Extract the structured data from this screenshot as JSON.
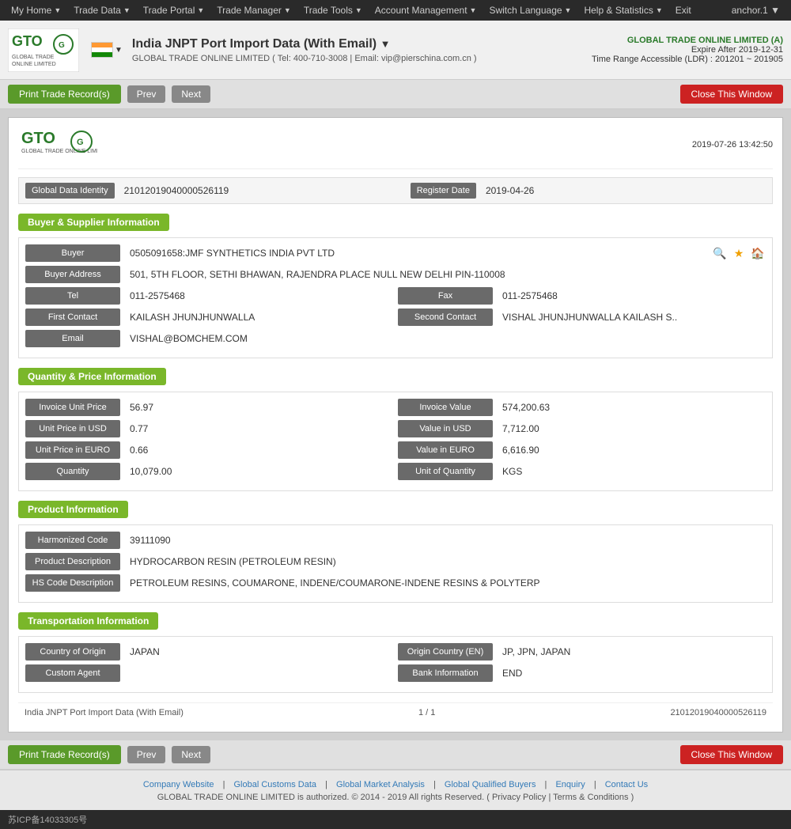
{
  "nav": {
    "items": [
      {
        "label": "My Home",
        "arrow": true
      },
      {
        "label": "Trade Data",
        "arrow": true
      },
      {
        "label": "Trade Portal",
        "arrow": true
      },
      {
        "label": "Trade Manager",
        "arrow": true
      },
      {
        "label": "Trade Tools",
        "arrow": true
      },
      {
        "label": "Account Management",
        "arrow": true
      },
      {
        "label": "Switch Language",
        "arrow": true
      },
      {
        "label": "Help & Statistics",
        "arrow": true
      },
      {
        "label": "Exit",
        "arrow": false
      }
    ],
    "anchor": "anchor.1 ▼"
  },
  "header": {
    "title": "India JNPT Port Import Data (With Email)",
    "title_arrow": "▼",
    "company_line": "GLOBAL TRADE ONLINE LIMITED ( Tel: 400-710-3008 | Email: vip@pierschina.com.cn )",
    "account_company": "GLOBAL TRADE ONLINE LIMITED (A)",
    "expire": "Expire After 2019-12-31",
    "ldr": "Time Range Accessible (LDR) : 201201 ~ 201905"
  },
  "toolbar": {
    "print_label": "Print Trade Record(s)",
    "prev_label": "Prev",
    "next_label": "Next",
    "close_label": "Close This Window"
  },
  "record": {
    "timestamp": "2019-07-26 13:42:50",
    "identity_label": "Global Data Identity",
    "identity_value": "21012019040000526119",
    "register_date_label": "Register Date",
    "register_date_value": "2019-04-26",
    "sections": {
      "buyer_supplier": {
        "title": "Buyer & Supplier Information",
        "buyer_label": "Buyer",
        "buyer_value": "0505091658:JMF SYNTHETICS INDIA PVT LTD",
        "buyer_address_label": "Buyer Address",
        "buyer_address_value": "501, 5TH FLOOR, SETHI BHAWAN, RAJENDRA PLACE NULL NEW DELHI PIN-110008",
        "tel_label": "Tel",
        "tel_value": "011-2575468",
        "fax_label": "Fax",
        "fax_value": "011-2575468",
        "first_contact_label": "First Contact",
        "first_contact_value": "KAILASH JHUNJHUNWALLA",
        "second_contact_label": "Second Contact",
        "second_contact_value": "VISHAL JHUNJHUNWALLA KAILASH S..",
        "email_label": "Email",
        "email_value": "VISHAL@BOMCHEM.COM"
      },
      "quantity_price": {
        "title": "Quantity & Price Information",
        "invoice_unit_price_label": "Invoice Unit Price",
        "invoice_unit_price_value": "56.97",
        "invoice_value_label": "Invoice Value",
        "invoice_value_value": "574,200.63",
        "unit_price_usd_label": "Unit Price in USD",
        "unit_price_usd_value": "0.77",
        "value_usd_label": "Value in USD",
        "value_usd_value": "7,712.00",
        "unit_price_euro_label": "Unit Price in EURO",
        "unit_price_euro_value": "0.66",
        "value_euro_label": "Value in EURO",
        "value_euro_value": "6,616.90",
        "quantity_label": "Quantity",
        "quantity_value": "10,079.00",
        "unit_of_quantity_label": "Unit of Quantity",
        "unit_of_quantity_value": "KGS"
      },
      "product": {
        "title": "Product Information",
        "harmonized_code_label": "Harmonized Code",
        "harmonized_code_value": "39111090",
        "product_description_label": "Product Description",
        "product_description_value": "HYDROCARBON RESIN (PETROLEUM RESIN)",
        "hs_code_description_label": "HS Code Description",
        "hs_code_description_value": "PETROLEUM RESINS, COUMARONE, INDENE/COUMARONE-INDENE RESINS & POLYTERP"
      },
      "transportation": {
        "title": "Transportation Information",
        "country_of_origin_label": "Country of Origin",
        "country_of_origin_value": "JAPAN",
        "origin_country_en_label": "Origin Country (EN)",
        "origin_country_en_value": "JP, JPN, JAPAN",
        "custom_agent_label": "Custom Agent",
        "custom_agent_value": "",
        "bank_information_label": "Bank Information",
        "bank_information_value": "END"
      }
    },
    "footer": {
      "left": "India JNPT Port Import Data (With Email)",
      "center": "1 / 1",
      "right": "21012019040000526119"
    }
  },
  "page_footer": {
    "links": [
      {
        "label": "Company Website"
      },
      {
        "label": "Global Customs Data"
      },
      {
        "label": "Global Market Analysis"
      },
      {
        "label": "Global Qualified Buyers"
      },
      {
        "label": "Enquiry"
      },
      {
        "label": "Contact Us"
      }
    ],
    "copyright": "GLOBAL TRADE ONLINE LIMITED is authorized. © 2014 - 2019 All rights Reserved.  (  Privacy Policy  |  Terms & Conditions  )",
    "icp": "苏ICP备14033305号"
  }
}
